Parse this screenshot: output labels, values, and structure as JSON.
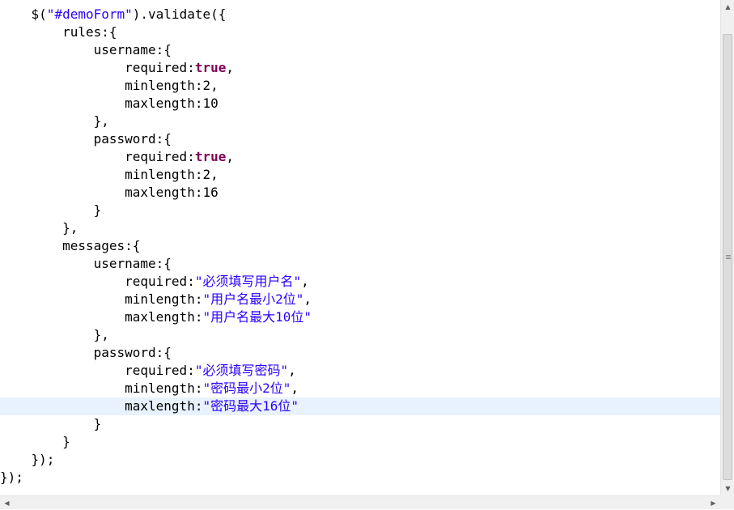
{
  "code_lines": [
    [
      {
        "t": "    $("
      },
      {
        "t": "\"#demoForm\"",
        "c": "str"
      },
      {
        "t": ").validate({"
      }
    ],
    [
      {
        "t": "        rules:{"
      }
    ],
    [
      {
        "t": "            username:{"
      }
    ],
    [
      {
        "t": "                required:"
      },
      {
        "t": "true",
        "c": "kw"
      },
      {
        "t": ","
      }
    ],
    [
      {
        "t": "                minlength:2,"
      }
    ],
    [
      {
        "t": "                maxlength:10"
      }
    ],
    [
      {
        "t": "            },"
      }
    ],
    [
      {
        "t": "            password:{"
      }
    ],
    [
      {
        "t": "                required:"
      },
      {
        "t": "true",
        "c": "kw"
      },
      {
        "t": ","
      }
    ],
    [
      {
        "t": "                minlength:2,"
      }
    ],
    [
      {
        "t": "                maxlength:16"
      }
    ],
    [
      {
        "t": "            }"
      }
    ],
    [
      {
        "t": "        },"
      }
    ],
    [
      {
        "t": "        messages:{"
      }
    ],
    [
      {
        "t": "            username:{"
      }
    ],
    [
      {
        "t": "                required:"
      },
      {
        "t": "\"必须填写用户名\"",
        "c": "str"
      },
      {
        "t": ","
      }
    ],
    [
      {
        "t": "                minlength:"
      },
      {
        "t": "\"用户名最小2位\"",
        "c": "str"
      },
      {
        "t": ","
      }
    ],
    [
      {
        "t": "                maxlength:"
      },
      {
        "t": "\"用户名最大10位\"",
        "c": "str"
      }
    ],
    [
      {
        "t": "            },"
      }
    ],
    [
      {
        "t": "            password:{"
      }
    ],
    [
      {
        "t": "                required:"
      },
      {
        "t": "\"必须填写密码\"",
        "c": "str"
      },
      {
        "t": ","
      }
    ],
    [
      {
        "t": "                minlength:"
      },
      {
        "t": "\"密码最小2位\"",
        "c": "str"
      },
      {
        "t": ","
      }
    ],
    [
      {
        "t": "                maxlength:"
      },
      {
        "t": "\"密码最大16位\"",
        "c": "str"
      }
    ],
    [
      {
        "t": "            }"
      }
    ],
    [
      {
        "t": "        }"
      }
    ],
    [
      {
        "t": "    });"
      }
    ],
    [
      {
        "t": "});"
      }
    ]
  ],
  "highlighted_line": 22,
  "colors": {
    "keyword": "#7f0055",
    "string": "#2a00ff",
    "current_line": "#e8f2fe"
  },
  "icons": {
    "scroll_up": "▲",
    "scroll_down": "▼",
    "scroll_left": "◀",
    "scroll_right": "▶"
  }
}
